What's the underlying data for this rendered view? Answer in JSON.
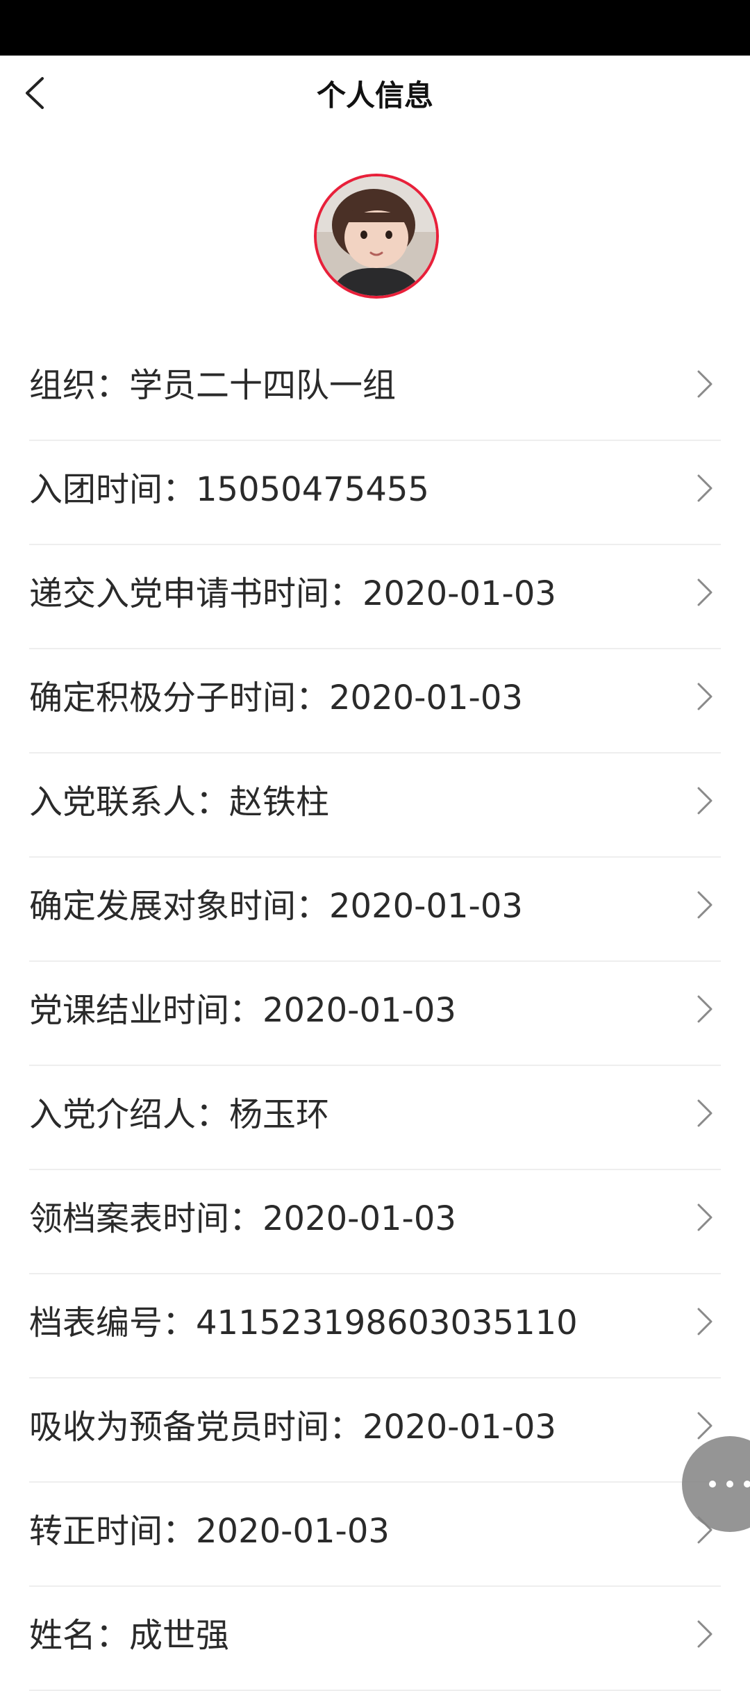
{
  "header": {
    "title": "个人信息",
    "back_icon": "chevron-left-icon"
  },
  "avatar": {
    "border_color": "#e8203a"
  },
  "info_rows": [
    {
      "text": "组织：学员二十四队一组"
    },
    {
      "text": "入团时间：15050475455"
    },
    {
      "text": "递交入党申请书时间：2020-01-03"
    },
    {
      "text": "确定积极分子时间：2020-01-03"
    },
    {
      "text": "入党联系人：赵铁柱"
    },
    {
      "text": "确定发展对象时间：2020-01-03"
    },
    {
      "text": "党课结业时间：2020-01-03"
    },
    {
      "text": "入党介绍人：杨玉环"
    },
    {
      "text": "领档案表时间：2020-01-03"
    },
    {
      "text": "档表编号：411523198603035110"
    },
    {
      "text": "吸收为预备党员时间：2020-01-03"
    },
    {
      "text": "转正时间：2020-01-03"
    },
    {
      "text": "姓名：成世强"
    }
  ],
  "row_icon": "chevron-right-icon",
  "floating_button": {
    "icon": "more-dots-icon"
  }
}
